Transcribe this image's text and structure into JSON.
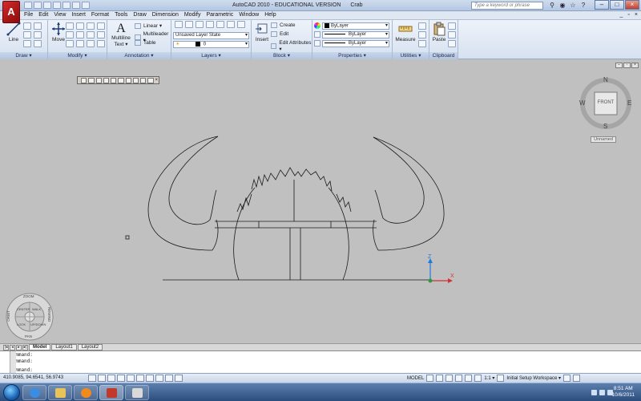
{
  "app": {
    "logo_letter": "A",
    "title": "AutoCAD 2010 - EDUCATIONAL VERSION",
    "document": "Crab",
    "search_placeholder": "Type a keyword or phrase",
    "accent": "#b71c1c"
  },
  "menu": {
    "items": [
      "File",
      "Edit",
      "View",
      "Insert",
      "Format",
      "Tools",
      "Draw",
      "Dimension",
      "Modify",
      "Parametric",
      "Window",
      "Help"
    ],
    "right_icons": [
      "_",
      "▫",
      "×"
    ]
  },
  "ribbon": {
    "draw": {
      "label": "Draw ▾",
      "line": "Line"
    },
    "modify": {
      "label": "Modify ▾",
      "move": "Move"
    },
    "annotation": {
      "label": "Annotation ▾",
      "text": "Multiline Text",
      "text_l1": "Multiline",
      "text_l2": "Text ▾",
      "linear": "Linear ▾",
      "multileader": "Multileader ▾",
      "table": "Table"
    },
    "layers": {
      "label": "Layers ▾",
      "state": "Unsaved Layer State",
      "current": "0"
    },
    "block": {
      "label": "Block ▾",
      "insert": "Insert",
      "create": "Create",
      "edit": "Edit",
      "edit_attr": "Edit Attributes ▾"
    },
    "properties": {
      "label": "Properties ▾",
      "color": "ByLayer",
      "linetype": "ByLayer",
      "lineweight": "ByLayer"
    },
    "utilities": {
      "label": "Utilities ▾",
      "measure": "Measure"
    },
    "clipboard": {
      "label": "Clipboard",
      "paste": "Paste"
    }
  },
  "viewcube": {
    "face": "FRONT",
    "n": "N",
    "s": "S",
    "e": "E",
    "w": "W",
    "view_name": "Unnamed"
  },
  "steering_wheel": {
    "zoom": "ZOOM",
    "orbit": "ORBIT",
    "rewind": "REWIND",
    "pan": "PAN",
    "center": "CENTER",
    "walk": "WALK",
    "look": "LOOK",
    "up_down": "UP/DOWN"
  },
  "layout_tabs": [
    "Model",
    "Layout1",
    "Layout2"
  ],
  "command": {
    "lines": [
      "Command:",
      "Command:",
      "Command:"
    ]
  },
  "status": {
    "coords": "410.9085, 94.6541, 56.9743",
    "model": "MODEL",
    "scale": "1:1 ▾",
    "workspace": "Initial Setup Workspace ▾"
  },
  "taskbar": {
    "time": "8:51 AM",
    "date": "10/6/2011"
  }
}
